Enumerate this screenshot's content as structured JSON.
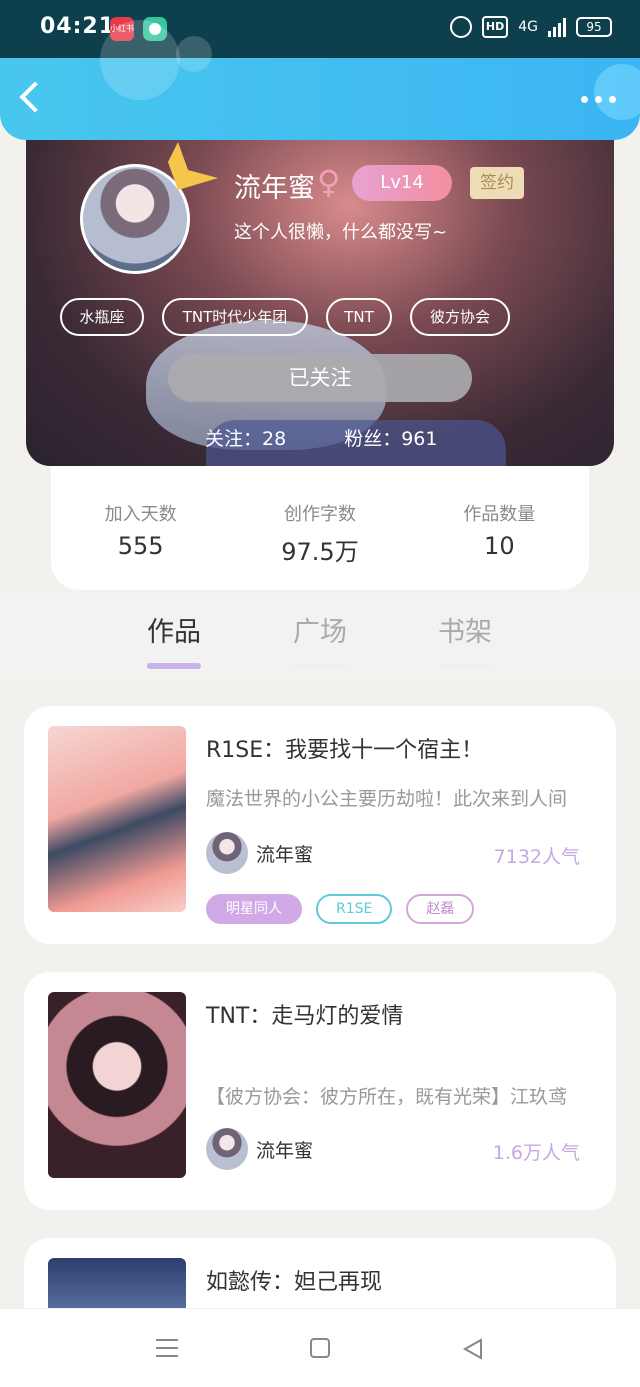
{
  "status_bar": {
    "time": "04:21",
    "app1_label": "小红书",
    "hd": "HD",
    "network": "4G",
    "battery": "95"
  },
  "profile": {
    "username": "流年蜜",
    "gender_symbol": "♀",
    "level": "Lv14",
    "signed": "签约",
    "bio": "这个人很懒，什么都没写~",
    "tags": [
      "水瓶座",
      "TNT时代少年团",
      "TNT",
      "彼方协会"
    ],
    "follow_button": "已关注",
    "following": "关注：28",
    "fans": "粉丝：961"
  },
  "stats": [
    {
      "label": "加入天数",
      "value": "555"
    },
    {
      "label": "创作字数",
      "value": "97.5万"
    },
    {
      "label": "作品数量",
      "value": "10"
    }
  ],
  "tabs": [
    "作品",
    "广场",
    "书架"
  ],
  "works": [
    {
      "title": "R1SE：我要找十一个宿主！",
      "desc": "魔法世界的小公主要历劫啦！此次来到人间",
      "author": "流年蜜",
      "popularity": "7132人气",
      "tags": [
        {
          "label": "明星同人"
        },
        {
          "label": "R1SE"
        },
        {
          "label": "赵磊"
        }
      ]
    },
    {
      "title": "TNT：走马灯的爱情",
      "desc": "【彼方协会：彼方所在，既有光荣】江玖鸢",
      "author": "流年蜜",
      "popularity": "1.6万人气"
    },
    {
      "title": "如懿传：妲己再现"
    }
  ],
  "colors": {
    "nav_gradient_start": "#48c7ee",
    "accent_purple": "#c9b2e6",
    "tag_teal": "#5dcbd8",
    "tag_pink": "#d4a6d6"
  }
}
